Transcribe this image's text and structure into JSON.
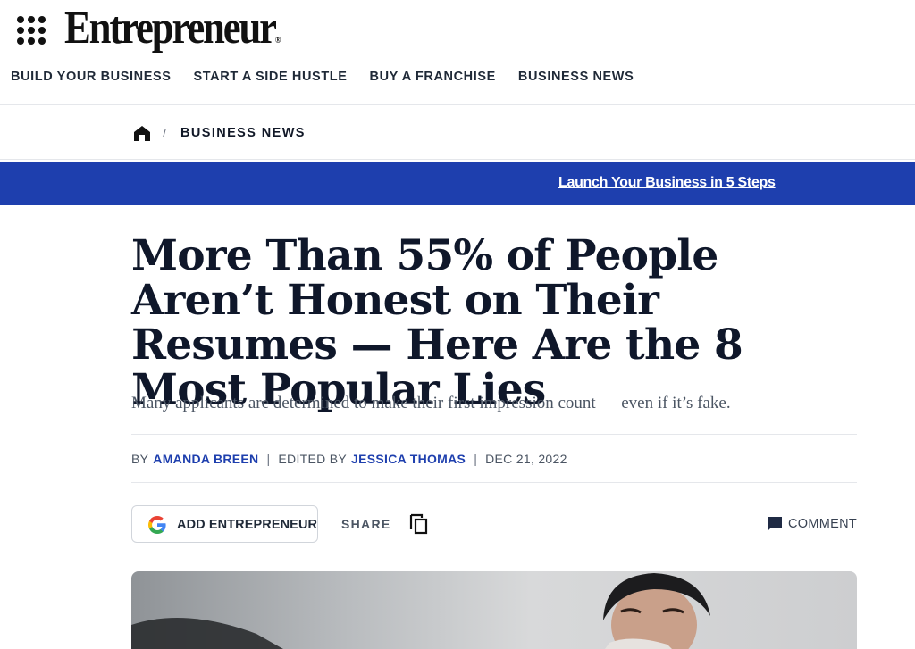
{
  "brand": {
    "logo_text": "Entrepreneur",
    "registered_mark": "®"
  },
  "main_nav": [
    {
      "label": "BUILD YOUR BUSINESS"
    },
    {
      "label": "START A SIDE HUSTLE"
    },
    {
      "label": "BUY A FRANCHISE"
    },
    {
      "label": "BUSINESS NEWS"
    }
  ],
  "breadcrumb": {
    "separator": "/",
    "section": "BUSINESS NEWS"
  },
  "promo": {
    "link_text": "Launch Your Business in 5 Steps",
    "background": "#1e3fae"
  },
  "article": {
    "headline": "More Than 55% of People Aren’t Honest on Their Resumes — Here Are the 8 Most Popular Lies",
    "dek": "Many applicants are determined to make their first impression count — even if it’s fake.",
    "byline": {
      "by_prefix": "BY",
      "author": "AMANDA BREEN",
      "edited_prefix": "EDITED BY",
      "editor": "JESSICA THOMAS",
      "date": "DEC 21, 2022",
      "separator": "|"
    },
    "actions": {
      "add_source_label": "ADD ENTREPRENEUR",
      "share_label": "SHARE",
      "comment_label": "COMMENT"
    }
  },
  "icons": [
    "menu-grid-icon",
    "home-icon",
    "google-icon",
    "copy-link-icon",
    "comment-icon"
  ],
  "colors": {
    "accent": "#1e3fae",
    "text": "#0f172a",
    "muted": "#4b5563"
  }
}
